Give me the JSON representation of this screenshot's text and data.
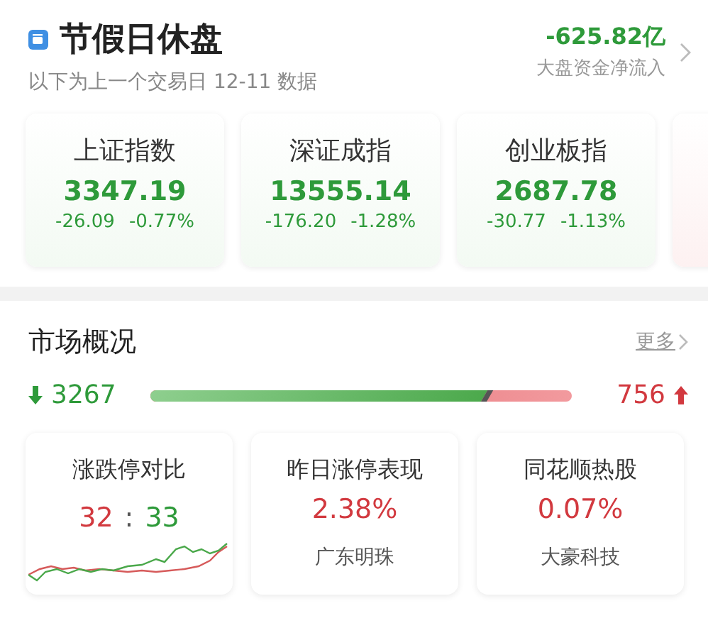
{
  "header": {
    "title": "节假日休盘",
    "subtitle": "以下为上一个交易日 12-11 数据",
    "flow_value": "-625.82亿",
    "flow_label": "大盘资金净流入"
  },
  "indices": [
    {
      "name": "上证指数",
      "value": "3347.19",
      "change": "-26.09",
      "percent": "-0.77%",
      "rising": false
    },
    {
      "name": "深证成指",
      "value": "13555.14",
      "change": "-176.20",
      "percent": "-1.28%",
      "rising": false
    },
    {
      "name": "创业板指",
      "value": "2687.78",
      "change": "-30.77",
      "percent": "-1.13%",
      "rising": false
    }
  ],
  "market": {
    "title": "市场概况",
    "more": "更多",
    "down_count": "3267",
    "up_count": "756",
    "level": 0.8
  },
  "cards": [
    {
      "kind": "ratio",
      "title": "涨跌停对比",
      "up": "32",
      "separator": ":",
      "down": "33"
    },
    {
      "kind": "stat",
      "title": "昨日涨停表现",
      "value": "2.38%",
      "rising": true,
      "stock": "广东明珠"
    },
    {
      "kind": "stat",
      "title": "同花顺热股",
      "value": "0.07%",
      "rising": true,
      "stock": "大豪科技"
    }
  ]
}
